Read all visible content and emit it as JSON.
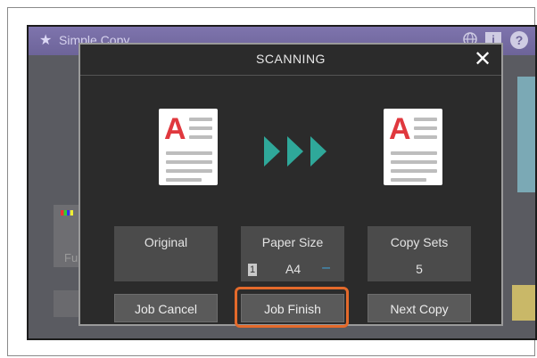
{
  "background_app": {
    "title": "Simple Copy",
    "star_icon": "★",
    "info_label": "i",
    "help_label": "?",
    "left_text": "Fu"
  },
  "dialog": {
    "title": "SCANNING",
    "close_label": "✕",
    "original_icon_letter": "A",
    "output_icon_letter": "A"
  },
  "info_boxes": {
    "original": {
      "label": "Original"
    },
    "paper_size": {
      "label": "Paper Size",
      "tray_number": "1",
      "value": "A4",
      "dash": "–"
    },
    "copy_sets": {
      "label": "Copy Sets",
      "value": "5"
    }
  },
  "buttons": {
    "job_cancel": "Job Cancel",
    "job_finish": "Job Finish",
    "next_copy": "Next Copy"
  },
  "colors": {
    "dialog_bg": "#2b2b2b",
    "titlebar": "#6d6499",
    "arrow": "#2fa89a",
    "highlight": "#e46a2b",
    "letter_red": "#e0383e"
  }
}
